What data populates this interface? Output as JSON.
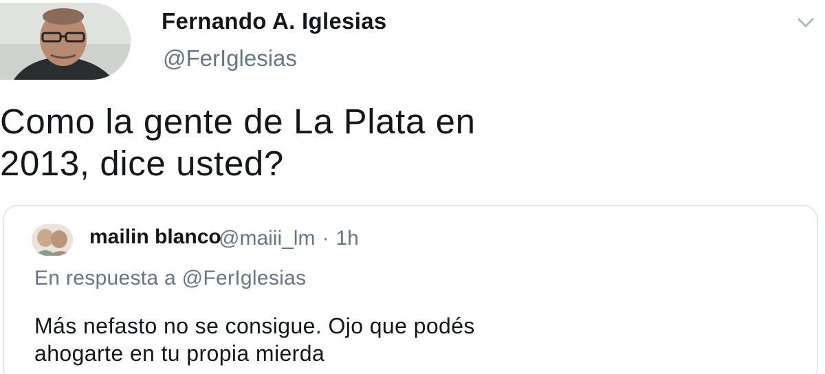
{
  "tweet": {
    "author_name": "Fernando A. Iglesias",
    "author_handle": "@FerIglesias",
    "text_line1": "Como la gente de La Plata en",
    "text_line2": "2013, dice usted?",
    "menu_icon": "chevron-down-icon"
  },
  "quoted_tweet": {
    "author_name": "mailin blanco",
    "author_handle": "@maiii_lm",
    "separator": "·",
    "time": "1h",
    "reply_to": "En respuesta a @FerIglesias",
    "text_line1": "Más nefasto no se consigue. Ojo que podés",
    "text_line2": "ahogarte en tu propia mierda"
  },
  "colors": {
    "text": "#14171a",
    "secondary_text": "#657786",
    "border": "#e1e8ed",
    "background": "#ffffff"
  }
}
